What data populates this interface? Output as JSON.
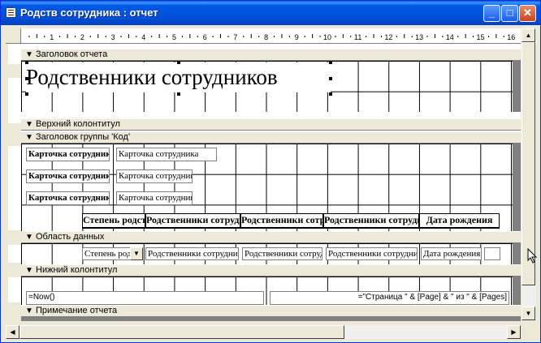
{
  "window": {
    "title": "Родств сотрудника : отчет"
  },
  "ruler": {
    "ticks": [
      "1",
      "2",
      "3",
      "4",
      "5",
      "6",
      "7",
      "8",
      "9",
      "10",
      "11",
      "12",
      "13",
      "14",
      "15",
      "16"
    ]
  },
  "sections": {
    "report_header": "Заголовок отчета",
    "page_header": "Верхний колонтитул",
    "group_header": "Заголовок группы 'Код'",
    "detail": "Область данных",
    "page_footer": "Нижний колонтитул",
    "report_footer": "Примечание отчета"
  },
  "report_title": "Родственники сотрудников",
  "group_labels": [
    "Карточка сотрудника",
    "Карточка сотрудника",
    "Карточка сотрудника"
  ],
  "group_fields": [
    "Карточка сотрудника",
    "Карточка сотрудника",
    "Карточка сотрудника"
  ],
  "column_headers": [
    "Степень родства",
    "Родственники сотрудника",
    "Родственники сотрудника",
    "Родственники сотрудника",
    "Дата рождения"
  ],
  "detail_fields": [
    "Степень родства",
    "Родственники сотрудника",
    "Родственники сотрудника",
    "Родственники сотрудника",
    "Дата рождения"
  ],
  "footer_now": "=Now()",
  "footer_page": "=\"Страница \" & [Page] & \" из \" & [Pages]"
}
